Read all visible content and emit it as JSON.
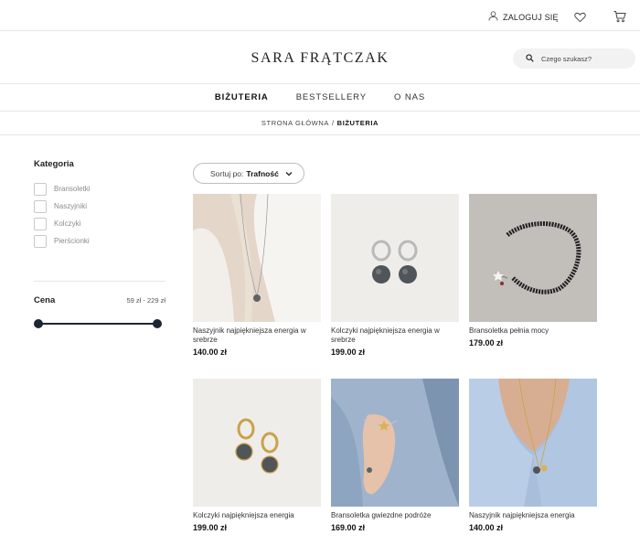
{
  "header": {
    "login_label": "ZALOGUJ SIĘ",
    "logo": "SARA FRĄTCZAK",
    "search_placeholder": "Czego szukasz?"
  },
  "nav": [
    {
      "label": "BIŻUTERIA",
      "active": true
    },
    {
      "label": "BESTSELLERY",
      "active": false
    },
    {
      "label": "O NAS",
      "active": false
    }
  ],
  "breadcrumb": {
    "home": "STRONA GŁÓWNA",
    "separator": "/",
    "current": "BIŻUTERIA"
  },
  "filters": {
    "category_title": "Kategoria",
    "categories": [
      "Bransoletki",
      "Naszyjniki",
      "Kolczyki",
      "Pierścionki"
    ],
    "price_title": "Cena",
    "price_range": "59 zł - 229 zł"
  },
  "sort": {
    "prefix": "Sortuj po:",
    "value": "Trafność"
  },
  "products": [
    {
      "name": "Naszyjnik najpiękniejsza energia w srebrze",
      "price": "140.00 zł"
    },
    {
      "name": "Kolczyki najpiękniejsza energia w srebrze",
      "price": "199.00 zł"
    },
    {
      "name": "Bransoletka pełnia mocy",
      "price": "179.00 zł"
    },
    {
      "name": "Kolczyki najpiękniejsza energia",
      "price": "199.00 zł"
    },
    {
      "name": "Bransoletka gwiezdne podróże",
      "price": "169.00 zł"
    },
    {
      "name": "Naszyjnik najpiękniejsza energia",
      "price": "140.00 zł"
    }
  ],
  "colors": {
    "accent": "#1e2636",
    "border": "#e6e6e6"
  }
}
